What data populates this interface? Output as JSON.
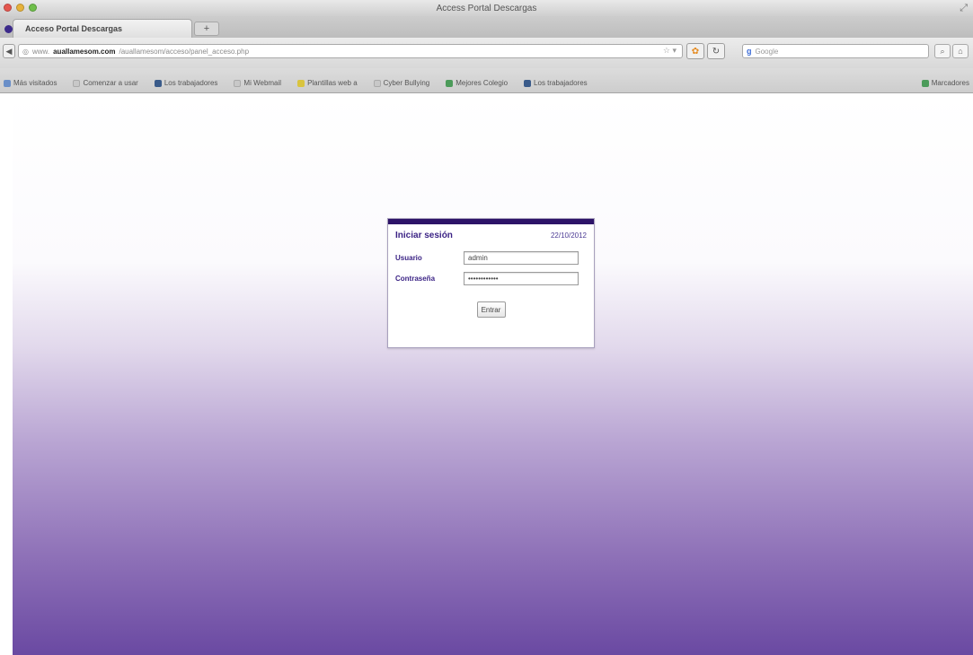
{
  "window": {
    "title": "Access Portal Descargas"
  },
  "tab": {
    "title": "Acceso Portal Descargas",
    "new_tab_label": "+"
  },
  "navbar": {
    "url_prefix": "www.",
    "url_domain": "auallamesom.com",
    "url_path": "/auallamesom/acceso/panel_acceso.php",
    "search_placeholder": "Google",
    "search_engine_letter": "g"
  },
  "bookmarks": [
    {
      "label": "Más visitados",
      "icon": "blue"
    },
    {
      "label": "Comenzar a usar",
      "icon": "gray"
    },
    {
      "label": "Los trabajadores",
      "icon": "navy"
    },
    {
      "label": "Mi Webmail",
      "icon": "gray"
    },
    {
      "label": "Plantillas web a",
      "icon": "yellow"
    },
    {
      "label": "Cyber Bullying",
      "icon": "gray"
    },
    {
      "label": "Mejores Colegio",
      "icon": "green"
    },
    {
      "label": "Los trabajadores",
      "icon": "navy"
    }
  ],
  "bookmarks_right": "Marcadores",
  "login": {
    "title": "Iniciar sesión",
    "date": "22/10/2012",
    "user_label": "Usuario",
    "user_value": "admin",
    "password_label": "Contraseña",
    "password_value": "••••••••••••",
    "submit_label": "Entrar"
  },
  "colors": {
    "accent": "#2d1468",
    "label": "#3b2385",
    "background_bottom": "#6a49a2"
  }
}
